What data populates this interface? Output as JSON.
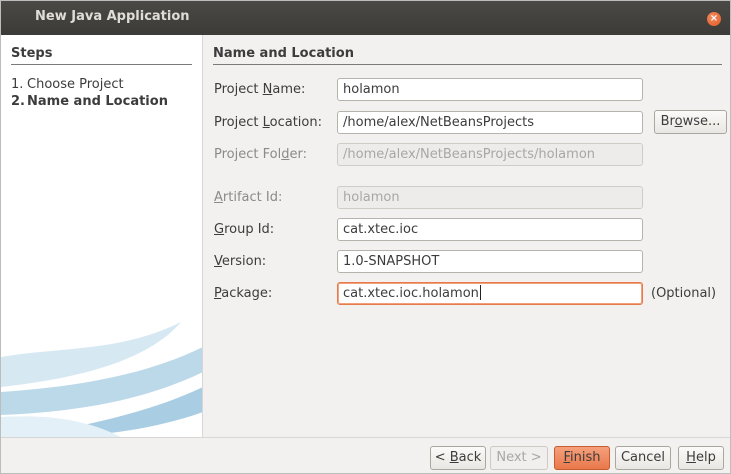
{
  "window": {
    "title": "New Java Application",
    "close_glyph": "×"
  },
  "steps": {
    "title": "Steps",
    "items": [
      {
        "num": "1.",
        "label": "Choose Project"
      },
      {
        "num": "2.",
        "label": "Name and Location"
      }
    ]
  },
  "panel": {
    "title": "Name and Location",
    "project_name": {
      "pre": "Project ",
      "mn": "N",
      "post": "ame:",
      "value": "holamon"
    },
    "project_location": {
      "pre": "Project ",
      "mn": "L",
      "post": "ocation:",
      "value": "/home/alex/NetBeansProjects"
    },
    "project_folder": {
      "pre": "Project Fol",
      "mn": "d",
      "post": "er:",
      "value": "/home/alex/NetBeansProjects/holamon"
    },
    "artifact_id": {
      "pre": "",
      "mn": "A",
      "post": "rtifact Id:",
      "value": "holamon"
    },
    "group_id": {
      "pre": "",
      "mn": "G",
      "post": "roup Id:",
      "value": "cat.xtec.ioc"
    },
    "version": {
      "pre": "",
      "mn": "V",
      "post": "ersion:",
      "value": "1.0-SNAPSHOT"
    },
    "package": {
      "pre": "",
      "mn": "P",
      "post": "ackage:",
      "value": "cat.xtec.ioc.holamon"
    },
    "browse": {
      "pre": "Br",
      "mn": "o",
      "post": "wse..."
    },
    "optional_note": "(Optional)"
  },
  "footer": {
    "back": {
      "pre": "< ",
      "mn": "B",
      "post": "ack"
    },
    "next": "Next >",
    "finish": {
      "pre": "",
      "mn": "F",
      "post": "inish"
    },
    "cancel": "Cancel",
    "help": {
      "pre": "",
      "mn": "H",
      "post": "elp"
    }
  },
  "colors": {
    "accent": "#e9784a",
    "titlebar": "#3c3b37"
  }
}
